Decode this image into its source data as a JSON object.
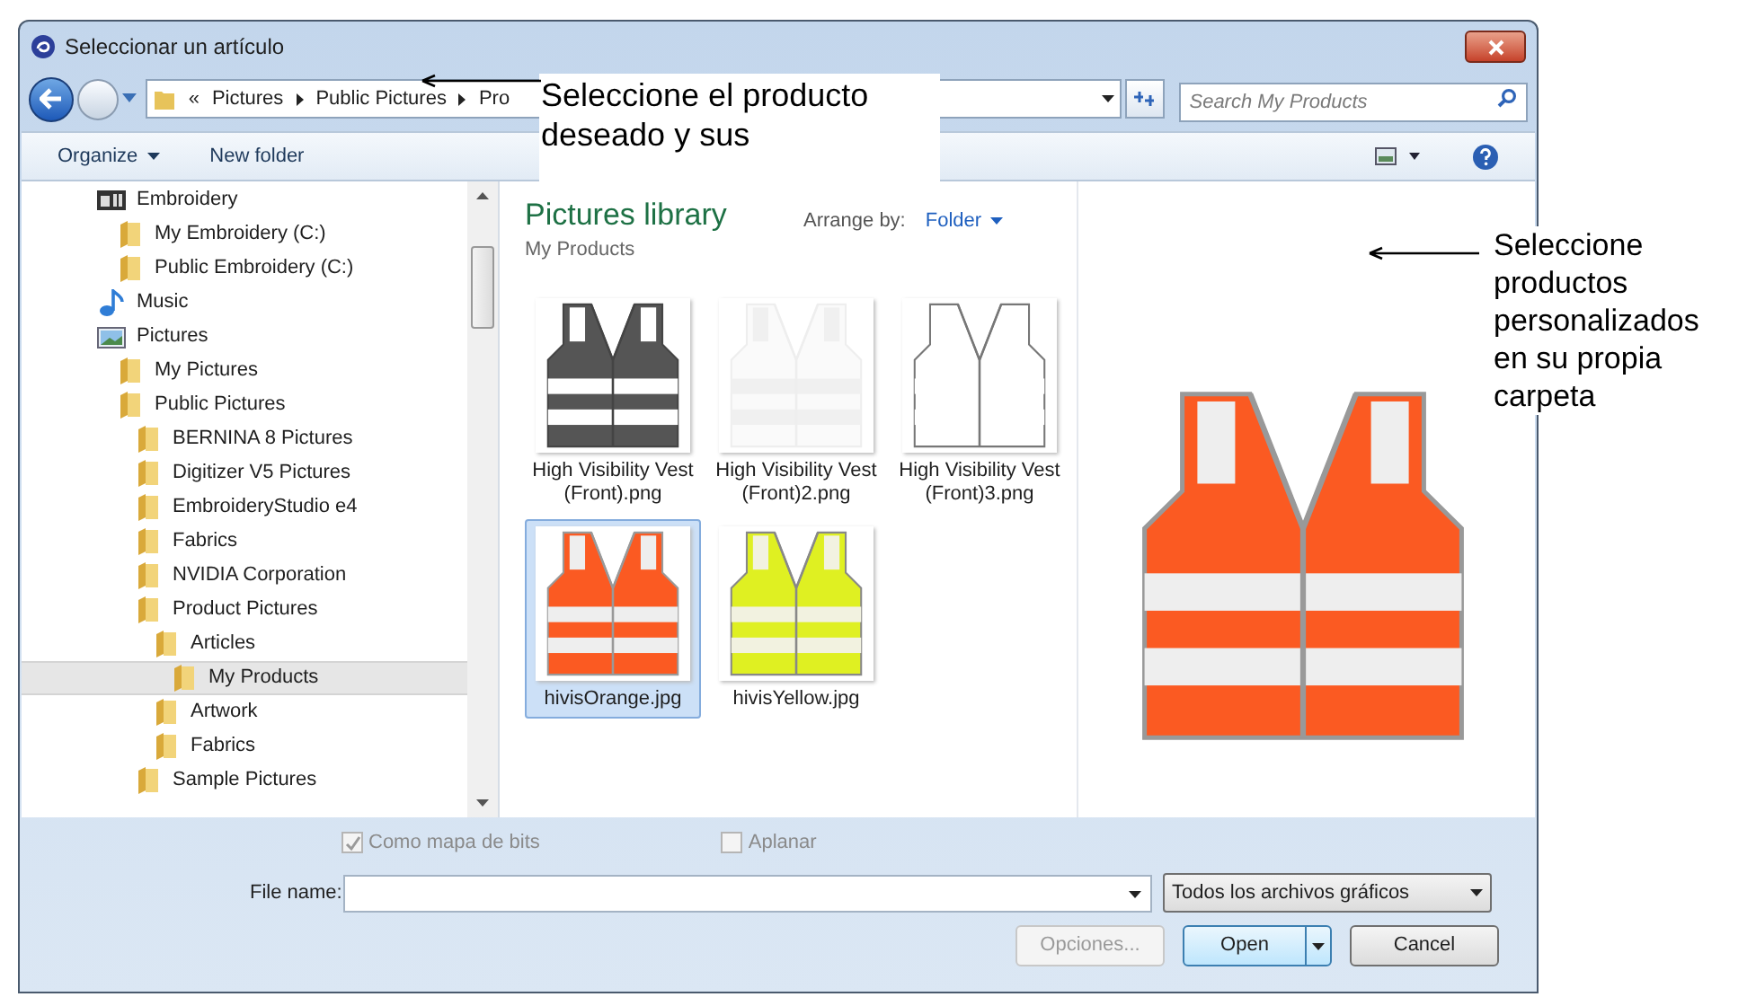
{
  "window": {
    "title": "Seleccionar un artículo"
  },
  "address_bar": {
    "overflow": "«",
    "crumbs": [
      "Pictures",
      "Public Pictures",
      "Pro"
    ]
  },
  "search": {
    "placeholder": "Search My Products"
  },
  "toolbar": {
    "organize": "Organize",
    "new_folder": "New folder"
  },
  "tree": [
    {
      "label": "Embroidery",
      "kind": "library",
      "selected": false,
      "children": [
        {
          "label": "My Embroidery (C:)",
          "kind": "folder",
          "selected": false
        },
        {
          "label": "Public Embroidery (C:)",
          "kind": "folder",
          "selected": false
        }
      ]
    },
    {
      "label": "Music",
      "kind": "music",
      "selected": false
    },
    {
      "label": "Pictures",
      "kind": "pictures",
      "selected": false,
      "children": [
        {
          "label": "My Pictures",
          "kind": "folder",
          "selected": false
        },
        {
          "label": "Public Pictures",
          "kind": "folder",
          "selected": false,
          "children": [
            {
              "label": "BERNINA 8 Pictures",
              "kind": "folder",
              "selected": false
            },
            {
              "label": "Digitizer V5 Pictures",
              "kind": "folder",
              "selected": false
            },
            {
              "label": "EmbroideryStudio e4",
              "kind": "folder",
              "selected": false
            },
            {
              "label": "Fabrics",
              "kind": "folder",
              "selected": false
            },
            {
              "label": "NVIDIA Corporation",
              "kind": "folder",
              "selected": false
            },
            {
              "label": "Product Pictures",
              "kind": "folder",
              "selected": false,
              "children": [
                {
                  "label": "Articles",
                  "kind": "folder",
                  "selected": false,
                  "children": [
                    {
                      "label": "My Products",
                      "kind": "folder",
                      "selected": true
                    }
                  ]
                },
                {
                  "label": "Artwork",
                  "kind": "folder",
                  "selected": false
                },
                {
                  "label": "Fabrics",
                  "kind": "folder",
                  "selected": false
                }
              ]
            },
            {
              "label": "Sample Pictures",
              "kind": "folder",
              "selected": false
            }
          ]
        }
      ]
    }
  ],
  "library": {
    "title": "Pictures library",
    "subtitle": "My Products",
    "arrange_label": "Arrange by:",
    "arrange_value": "Folder"
  },
  "files": [
    {
      "name": "High Visibility Vest (Front).png",
      "selected": false
    },
    {
      "name": "High Visibility Vest (Front)2.png",
      "selected": false
    },
    {
      "name": "High Visibility Vest (Front)3.png",
      "selected": false
    },
    {
      "name": "hivisOrange.jpg",
      "selected": true
    },
    {
      "name": "hivisYellow.jpg",
      "selected": false
    }
  ],
  "options": [
    {
      "label": "Como mapa de bits",
      "checked": true
    },
    {
      "label": "Aplanar",
      "checked": false
    }
  ],
  "file_name": {
    "label": "File name:"
  },
  "file_type": "Todos los archivos gráficos",
  "buttons": [
    {
      "label": "Opciones...",
      "disabled": true
    },
    {
      "label": "Open",
      "disabled": false,
      "split": true
    },
    {
      "label": "Cancel",
      "disabled": false
    }
  ],
  "callouts": [
    "Seleccione el producto deseado y sus",
    "Seleccione productos personalizados en su propia carpeta"
  ]
}
